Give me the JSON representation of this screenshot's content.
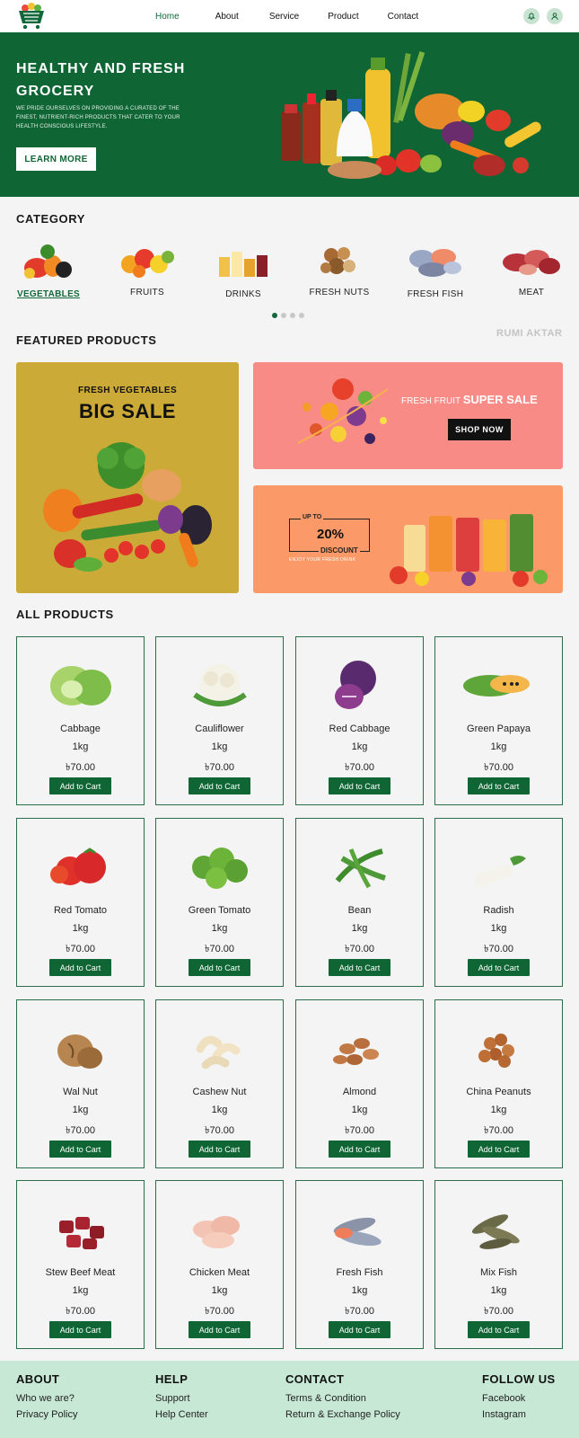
{
  "nav": {
    "links": [
      "Home",
      "About",
      "Service",
      "Product",
      "Contact"
    ],
    "active": "Home",
    "icons": [
      "bell-icon",
      "user-icon"
    ]
  },
  "hero": {
    "title_line1": "HEALTHY AND FRESH",
    "title_line2": "GROCERY",
    "subtitle": "WE PRIDE OURSELVES ON PROVIDING A CURATED OF THE FINEST, NUTRIENT-RICH PRODUCTS THAT CATER TO YOUR HEALTH CONSCIOUS LIFESTYLE.",
    "button": "LEARN MORE"
  },
  "category": {
    "title": "CATEGORY",
    "items": [
      "VEGETABLES",
      "FRUITS",
      "DRINKS",
      "FRESH NUTS",
      "FRESH FISH",
      "MEAT"
    ],
    "active": "VEGETABLES"
  },
  "watermark": "RUMI AKTAR",
  "featured": {
    "title": "FEATURED PRODUCTS",
    "veg_small": "FRESH VEGETABLES",
    "veg_big": "BIG SALE",
    "fruit_lite": "FRESH FRUIT ",
    "fruit_bold": "SUPER SALE",
    "fruit_button": "SHOP NOW",
    "drink_upto": "UP TO",
    "drink_pct": "20%",
    "drink_word": "DISCOUNT",
    "drink_sub": "ENJOY YOUR FRESH DRINK"
  },
  "products": {
    "title": "ALL PRODUCTS",
    "button": "Add to Cart",
    "items": [
      {
        "name": "Cabbage",
        "qty": "1kg",
        "price": "৳70.00"
      },
      {
        "name": "Cauliflower",
        "qty": "1kg",
        "price": "৳70.00"
      },
      {
        "name": "Red Cabbage",
        "qty": "1kg",
        "price": "৳70.00"
      },
      {
        "name": "Green Papaya",
        "qty": "1kg",
        "price": "৳70.00"
      },
      {
        "name": "Red Tomato",
        "qty": "1kg",
        "price": "৳70.00"
      },
      {
        "name": "Green Tomato",
        "qty": "1kg",
        "price": "৳70.00"
      },
      {
        "name": "Bean",
        "qty": "1kg",
        "price": "৳70.00"
      },
      {
        "name": "Radish",
        "qty": "1kg",
        "price": "৳70.00"
      },
      {
        "name": "Wal Nut",
        "qty": "1kg",
        "price": "৳70.00"
      },
      {
        "name": "Cashew Nut",
        "qty": "1kg",
        "price": "৳70.00"
      },
      {
        "name": "Almond",
        "qty": "1kg",
        "price": "৳70.00"
      },
      {
        "name": "China Peanuts",
        "qty": "1kg",
        "price": "৳70.00"
      },
      {
        "name": "Stew Beef Meat",
        "qty": "1kg",
        "price": "৳70.00"
      },
      {
        "name": "Chicken Meat",
        "qty": "1kg",
        "price": "৳70.00"
      },
      {
        "name": "Fresh Fish",
        "qty": "1kg",
        "price": "৳70.00"
      },
      {
        "name": "Mix Fish",
        "qty": "1kg",
        "price": "৳70.00"
      }
    ]
  },
  "footer": {
    "about": {
      "title": "ABOUT",
      "links": [
        "Who we are?",
        "Privacy Policy"
      ]
    },
    "help": {
      "title": "HELP",
      "links": [
        "Support",
        "Help Center"
      ]
    },
    "contact": {
      "title": "CONTACT",
      "links": [
        "Terms & Condition",
        "Return & Exchange Policy"
      ]
    },
    "follow": {
      "title": "FOLLOW US",
      "links": [
        "Facebook",
        "Instagram"
      ]
    }
  },
  "colors": {
    "brand_green": "#0f6634",
    "veg_banner": "#ccaa37",
    "fruit_banner": "#f98b86",
    "drink_banner": "#fb9968",
    "footer_bg": "#c8e8d6"
  }
}
